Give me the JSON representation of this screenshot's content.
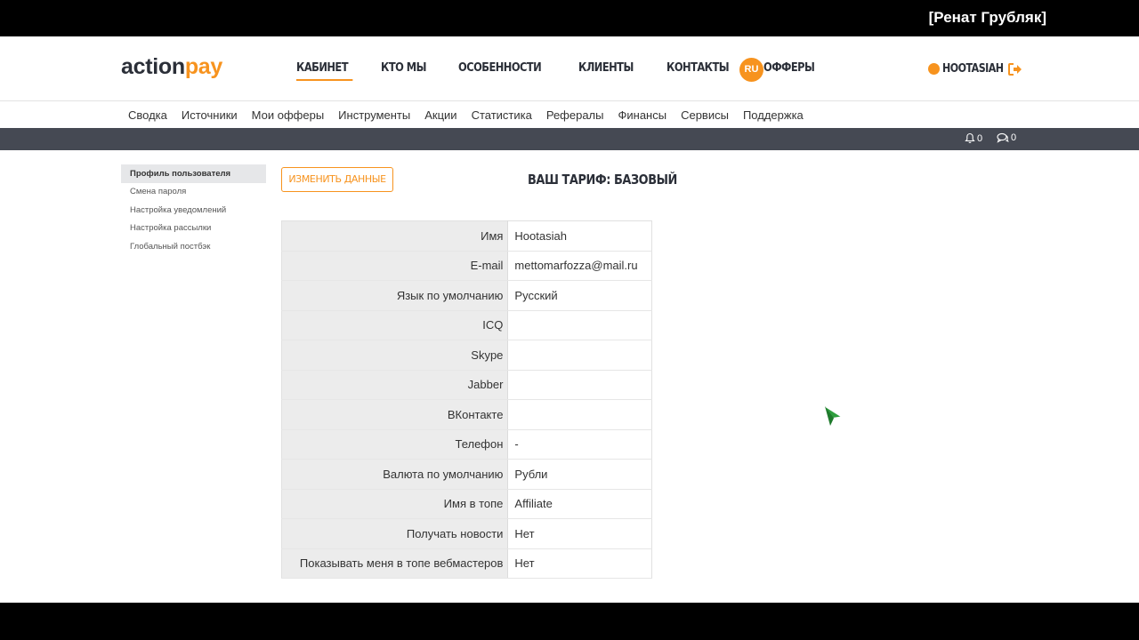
{
  "watermark": "[Ренат Грубляк]",
  "header": {
    "logo_action": "action",
    "logo_pay": "pay",
    "main_nav": [
      {
        "label": "КАБИНЕТ",
        "active": true
      },
      {
        "label": "КТО МЫ"
      },
      {
        "label": "ОСОБЕННОСТИ"
      },
      {
        "label": "КЛИЕНТЫ"
      },
      {
        "label": "КОНТАКТЫ"
      },
      {
        "label": "ОФФЕРЫ"
      }
    ],
    "language": "RU",
    "username": "HOOTASIAH"
  },
  "sub_nav": [
    "Сводка",
    "Источники",
    "Мои офферы",
    "Инструменты",
    "Акции",
    "Статистика",
    "Рефералы",
    "Финансы",
    "Сервисы",
    "Поддержка"
  ],
  "status_bar": {
    "notifications_count": "0",
    "messages_count": "0"
  },
  "sidebar": {
    "items": [
      {
        "label": "Профиль пользователя",
        "active": true
      },
      {
        "label": "Смена пароля"
      },
      {
        "label": "Настройка уведомлений"
      },
      {
        "label": "Настройка рассылки"
      },
      {
        "label": "Глобальный постбэк"
      }
    ]
  },
  "content": {
    "edit_button": "ИЗМЕНИТЬ ДАННЫЕ",
    "tariff_title": "ВАШ ТАРИФ: БАЗОВЫЙ",
    "rows": [
      {
        "label": "Имя",
        "value": "Hootasiah"
      },
      {
        "label": "E-mail",
        "value": "mettomarfozza@mail.ru"
      },
      {
        "label": "Язык по умолчанию",
        "value": "Русский"
      },
      {
        "label": "ICQ",
        "value": ""
      },
      {
        "label": "Skype",
        "value": ""
      },
      {
        "label": "Jabber",
        "value": ""
      },
      {
        "label": "ВКонтакте",
        "value": ""
      },
      {
        "label": "Телефон",
        "value": "-"
      },
      {
        "label": "Валюта по умолчанию",
        "value": "Рубли"
      },
      {
        "label": "Имя в топе",
        "value": "Affiliate"
      },
      {
        "label": "Получать новости",
        "value": "Нет"
      },
      {
        "label": "Показывать меня в топе вебмастеров",
        "value": "Нет"
      }
    ]
  },
  "colors": {
    "accent": "#f7931e",
    "dark_bar": "#454953",
    "text_dark": "#2b2f38"
  }
}
